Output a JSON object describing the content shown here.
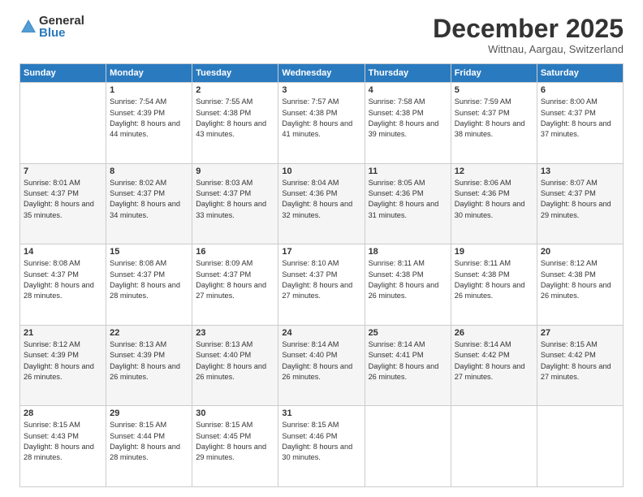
{
  "logo": {
    "general": "General",
    "blue": "Blue"
  },
  "header": {
    "month": "December 2025",
    "location": "Wittnau, Aargau, Switzerland"
  },
  "weekdays": [
    "Sunday",
    "Monday",
    "Tuesday",
    "Wednesday",
    "Thursday",
    "Friday",
    "Saturday"
  ],
  "weeks": [
    [
      {
        "day": "",
        "sunrise": "",
        "sunset": "",
        "daylight": ""
      },
      {
        "day": "1",
        "sunrise": "Sunrise: 7:54 AM",
        "sunset": "Sunset: 4:39 PM",
        "daylight": "Daylight: 8 hours and 44 minutes."
      },
      {
        "day": "2",
        "sunrise": "Sunrise: 7:55 AM",
        "sunset": "Sunset: 4:38 PM",
        "daylight": "Daylight: 8 hours and 43 minutes."
      },
      {
        "day": "3",
        "sunrise": "Sunrise: 7:57 AM",
        "sunset": "Sunset: 4:38 PM",
        "daylight": "Daylight: 8 hours and 41 minutes."
      },
      {
        "day": "4",
        "sunrise": "Sunrise: 7:58 AM",
        "sunset": "Sunset: 4:38 PM",
        "daylight": "Daylight: 8 hours and 39 minutes."
      },
      {
        "day": "5",
        "sunrise": "Sunrise: 7:59 AM",
        "sunset": "Sunset: 4:37 PM",
        "daylight": "Daylight: 8 hours and 38 minutes."
      },
      {
        "day": "6",
        "sunrise": "Sunrise: 8:00 AM",
        "sunset": "Sunset: 4:37 PM",
        "daylight": "Daylight: 8 hours and 37 minutes."
      }
    ],
    [
      {
        "day": "7",
        "sunrise": "Sunrise: 8:01 AM",
        "sunset": "Sunset: 4:37 PM",
        "daylight": "Daylight: 8 hours and 35 minutes."
      },
      {
        "day": "8",
        "sunrise": "Sunrise: 8:02 AM",
        "sunset": "Sunset: 4:37 PM",
        "daylight": "Daylight: 8 hours and 34 minutes."
      },
      {
        "day": "9",
        "sunrise": "Sunrise: 8:03 AM",
        "sunset": "Sunset: 4:37 PM",
        "daylight": "Daylight: 8 hours and 33 minutes."
      },
      {
        "day": "10",
        "sunrise": "Sunrise: 8:04 AM",
        "sunset": "Sunset: 4:36 PM",
        "daylight": "Daylight: 8 hours and 32 minutes."
      },
      {
        "day": "11",
        "sunrise": "Sunrise: 8:05 AM",
        "sunset": "Sunset: 4:36 PM",
        "daylight": "Daylight: 8 hours and 31 minutes."
      },
      {
        "day": "12",
        "sunrise": "Sunrise: 8:06 AM",
        "sunset": "Sunset: 4:36 PM",
        "daylight": "Daylight: 8 hours and 30 minutes."
      },
      {
        "day": "13",
        "sunrise": "Sunrise: 8:07 AM",
        "sunset": "Sunset: 4:37 PM",
        "daylight": "Daylight: 8 hours and 29 minutes."
      }
    ],
    [
      {
        "day": "14",
        "sunrise": "Sunrise: 8:08 AM",
        "sunset": "Sunset: 4:37 PM",
        "daylight": "Daylight: 8 hours and 28 minutes."
      },
      {
        "day": "15",
        "sunrise": "Sunrise: 8:08 AM",
        "sunset": "Sunset: 4:37 PM",
        "daylight": "Daylight: 8 hours and 28 minutes."
      },
      {
        "day": "16",
        "sunrise": "Sunrise: 8:09 AM",
        "sunset": "Sunset: 4:37 PM",
        "daylight": "Daylight: 8 hours and 27 minutes."
      },
      {
        "day": "17",
        "sunrise": "Sunrise: 8:10 AM",
        "sunset": "Sunset: 4:37 PM",
        "daylight": "Daylight: 8 hours and 27 minutes."
      },
      {
        "day": "18",
        "sunrise": "Sunrise: 8:11 AM",
        "sunset": "Sunset: 4:38 PM",
        "daylight": "Daylight: 8 hours and 26 minutes."
      },
      {
        "day": "19",
        "sunrise": "Sunrise: 8:11 AM",
        "sunset": "Sunset: 4:38 PM",
        "daylight": "Daylight: 8 hours and 26 minutes."
      },
      {
        "day": "20",
        "sunrise": "Sunrise: 8:12 AM",
        "sunset": "Sunset: 4:38 PM",
        "daylight": "Daylight: 8 hours and 26 minutes."
      }
    ],
    [
      {
        "day": "21",
        "sunrise": "Sunrise: 8:12 AM",
        "sunset": "Sunset: 4:39 PM",
        "daylight": "Daylight: 8 hours and 26 minutes."
      },
      {
        "day": "22",
        "sunrise": "Sunrise: 8:13 AM",
        "sunset": "Sunset: 4:39 PM",
        "daylight": "Daylight: 8 hours and 26 minutes."
      },
      {
        "day": "23",
        "sunrise": "Sunrise: 8:13 AM",
        "sunset": "Sunset: 4:40 PM",
        "daylight": "Daylight: 8 hours and 26 minutes."
      },
      {
        "day": "24",
        "sunrise": "Sunrise: 8:14 AM",
        "sunset": "Sunset: 4:40 PM",
        "daylight": "Daylight: 8 hours and 26 minutes."
      },
      {
        "day": "25",
        "sunrise": "Sunrise: 8:14 AM",
        "sunset": "Sunset: 4:41 PM",
        "daylight": "Daylight: 8 hours and 26 minutes."
      },
      {
        "day": "26",
        "sunrise": "Sunrise: 8:14 AM",
        "sunset": "Sunset: 4:42 PM",
        "daylight": "Daylight: 8 hours and 27 minutes."
      },
      {
        "day": "27",
        "sunrise": "Sunrise: 8:15 AM",
        "sunset": "Sunset: 4:42 PM",
        "daylight": "Daylight: 8 hours and 27 minutes."
      }
    ],
    [
      {
        "day": "28",
        "sunrise": "Sunrise: 8:15 AM",
        "sunset": "Sunset: 4:43 PM",
        "daylight": "Daylight: 8 hours and 28 minutes."
      },
      {
        "day": "29",
        "sunrise": "Sunrise: 8:15 AM",
        "sunset": "Sunset: 4:44 PM",
        "daylight": "Daylight: 8 hours and 28 minutes."
      },
      {
        "day": "30",
        "sunrise": "Sunrise: 8:15 AM",
        "sunset": "Sunset: 4:45 PM",
        "daylight": "Daylight: 8 hours and 29 minutes."
      },
      {
        "day": "31",
        "sunrise": "Sunrise: 8:15 AM",
        "sunset": "Sunset: 4:46 PM",
        "daylight": "Daylight: 8 hours and 30 minutes."
      },
      {
        "day": "",
        "sunrise": "",
        "sunset": "",
        "daylight": ""
      },
      {
        "day": "",
        "sunrise": "",
        "sunset": "",
        "daylight": ""
      },
      {
        "day": "",
        "sunrise": "",
        "sunset": "",
        "daylight": ""
      }
    ]
  ]
}
